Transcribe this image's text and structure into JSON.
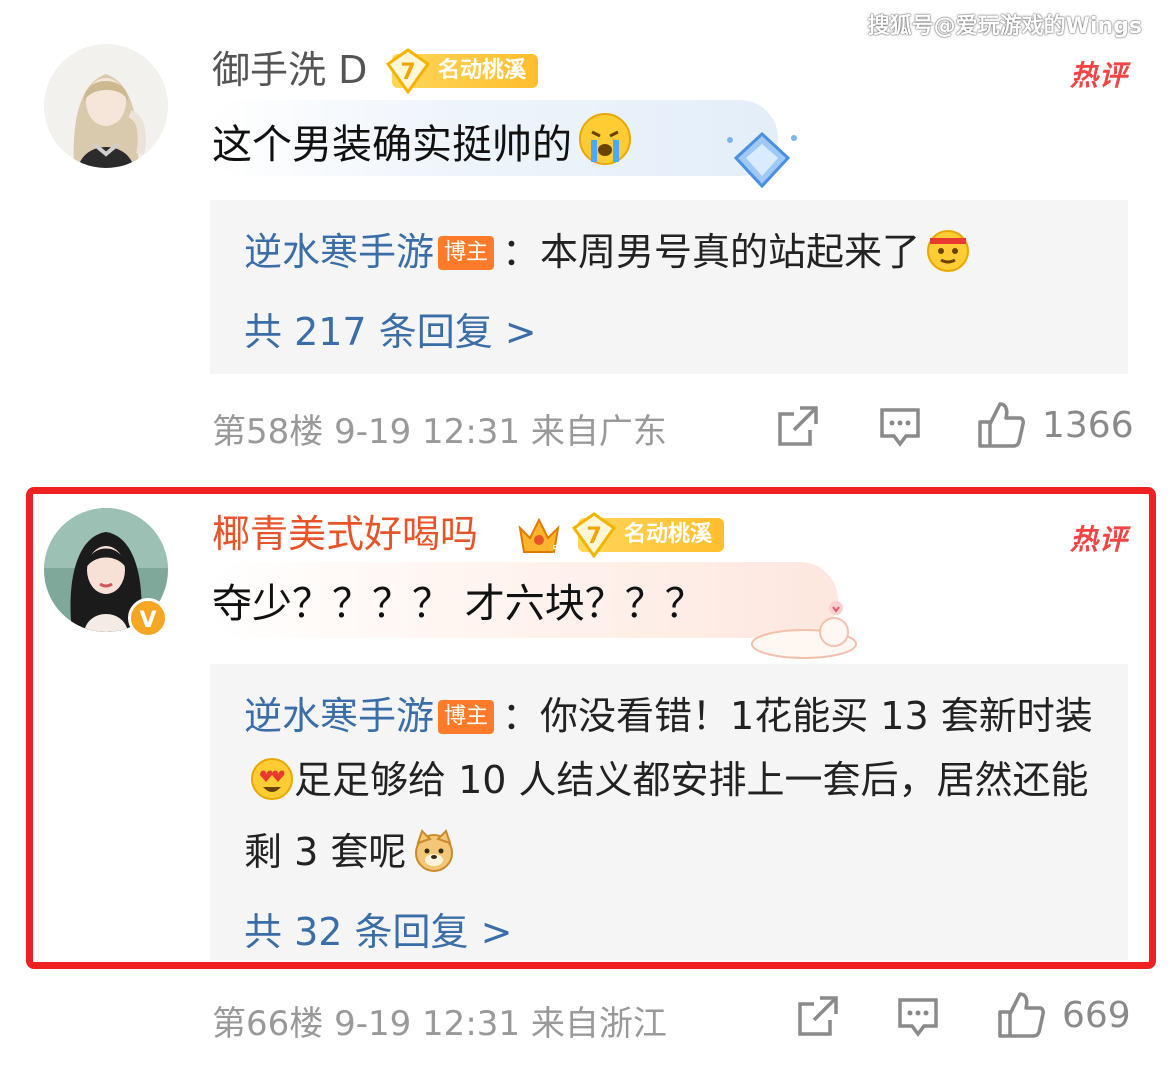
{
  "watermark": "搜狐号@爱玩游戏的Wings",
  "comments": [
    {
      "username": "御手洗 D",
      "badge_level": "7",
      "badge_text": "名动桃溪",
      "hot_label": "热评",
      "content": "这个男装确实挺帅的",
      "emoji": "crying-face-emoji",
      "reply": {
        "author": "逆水寒手游",
        "author_tag": "博主",
        "text": "：本周男号真的站起来了",
        "emoji": "determined-face-emoji",
        "more": "共 217 条回复 >"
      },
      "floor": "第58楼",
      "time": "9-19 12:31",
      "location": "来自广东",
      "likes": "1366"
    },
    {
      "username": "椰青美式好喝吗",
      "username_color": "#e8542a",
      "badge_level": "7",
      "badge_text": "名动桃溪",
      "crown_level": "5",
      "hot_label": "热评",
      "content": "夺少？？？？ 才六块？？？",
      "verified": "V",
      "reply": {
        "author": "逆水寒手游",
        "author_tag": "博主",
        "text_1": "：你没看错！1花能买 13 套新时装",
        "text_2": "足足够给 10 人结义都安排上一套后，居然还能剩 3 套呢",
        "emoji_1": "heart-eyes-emoji",
        "emoji_2": "doge-emoji",
        "more": "共 32 条回复 >"
      },
      "floor": "第66楼",
      "time": "9-19 12:31",
      "location": "来自浙江",
      "likes": "669"
    }
  ],
  "colors": {
    "highlight_border": "#ee2222",
    "link_blue": "#3b6ea8",
    "hot_red": "#f24545",
    "badge_gold": "#ffbe2e"
  }
}
